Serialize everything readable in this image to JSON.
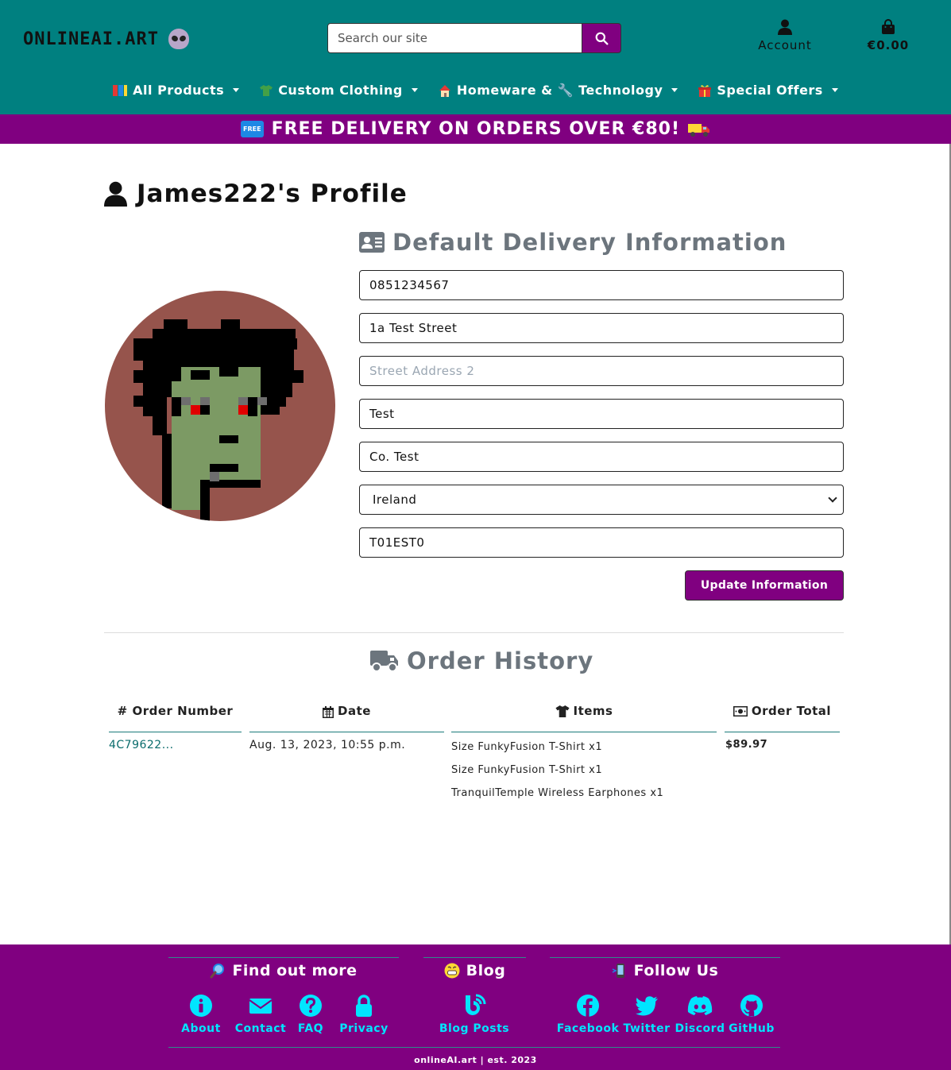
{
  "header": {
    "logo": "ONLINEAI.ART",
    "search_placeholder": "Search our site",
    "account_label": "Account",
    "bag_total": "€0.00"
  },
  "nav": {
    "items": [
      {
        "label": "All Products",
        "icon": "books-icon"
      },
      {
        "label": "Custom Clothing",
        "icon": "tshirt-icon"
      },
      {
        "label": "Homeware & 🔧 Technology",
        "icon": "house-icon"
      },
      {
        "label": "Special Offers",
        "icon": "gift-icon"
      }
    ]
  },
  "banner": {
    "badge": "FREE",
    "text": "FREE DELIVERY ON ORDERS OVER €80!"
  },
  "profile": {
    "title": "James222's Profile"
  },
  "delivery": {
    "title": "Default Delivery Information",
    "phone": "0851234567",
    "street1": "1a Test Street",
    "street2_placeholder": "Street Address 2",
    "town": "Test",
    "county": "Co. Test",
    "country": "Ireland",
    "postcode": "T01EST0",
    "update_label": "Update Information"
  },
  "history": {
    "title": "Order History",
    "headers": {
      "order_number": "# Order Number",
      "date": "Date",
      "items": "Items",
      "total": "Order Total"
    },
    "orders": [
      {
        "number": "4C79622...",
        "date": "Aug. 13, 2023, 10:55 p.m.",
        "items": [
          "Size FunkyFusion T-Shirt x1",
          "Size FunkyFusion T-Shirt x1",
          "TranquilTemple Wireless Earphones x1"
        ],
        "total": "$89.97"
      }
    ]
  },
  "footer": {
    "find_out_more": {
      "title": "Find out more",
      "links": [
        "About",
        "Contact",
        "FAQ",
        "Privacy"
      ]
    },
    "blog": {
      "title": "Blog",
      "links": [
        "Blog Posts"
      ]
    },
    "follow": {
      "title": "Follow Us",
      "links": [
        "Facebook",
        "Twitter",
        "Discord",
        "GitHub"
      ]
    },
    "copyright": "onlineAI.art | est. 2023"
  },
  "colors": {
    "header_bg": "#008080",
    "accent": "#800080",
    "footer_link": "#00e5ff"
  }
}
